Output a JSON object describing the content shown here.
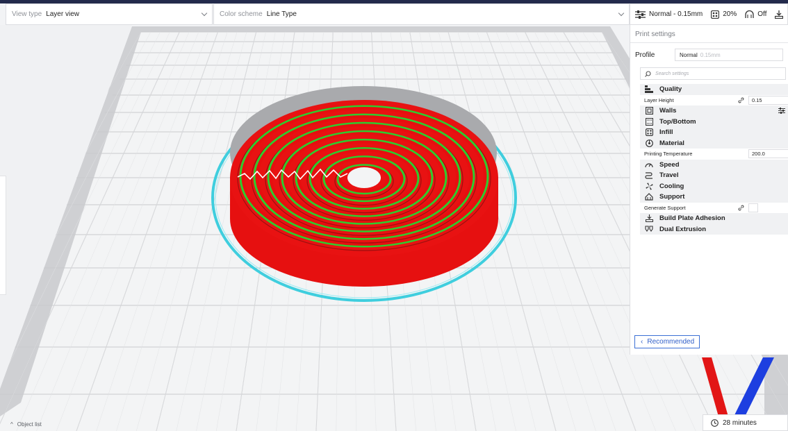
{
  "toolbar": {
    "view_type_label": "View type",
    "view_type_value": "Layer view",
    "color_scheme_label": "Color scheme",
    "color_scheme_value": "Line Type"
  },
  "print_bar": {
    "profile": "Normal - 0.15mm",
    "infill": "20%",
    "support": "Off"
  },
  "panel": {
    "title": "Print settings",
    "profile_label": "Profile",
    "profile_value": "Normal",
    "profile_sub": "0.15mm",
    "search_placeholder": "Search settings",
    "categories": [
      {
        "label": "Quality",
        "icon": "quality-icon"
      },
      {
        "label": "Walls",
        "icon": "walls-icon"
      },
      {
        "label": "Top/Bottom",
        "icon": "top-bottom-icon"
      },
      {
        "label": "Infill",
        "icon": "infill-icon"
      },
      {
        "label": "Material",
        "icon": "material-icon"
      },
      {
        "label": "Speed",
        "icon": "speed-icon"
      },
      {
        "label": "Travel",
        "icon": "travel-icon"
      },
      {
        "label": "Cooling",
        "icon": "cooling-icon"
      },
      {
        "label": "Support",
        "icon": "support-icon"
      },
      {
        "label": "Build Plate Adhesion",
        "icon": "adhesion-icon"
      },
      {
        "label": "Dual Extrusion",
        "icon": "dual-extrusion-icon"
      }
    ],
    "settings": {
      "layer_height_label": "Layer Height",
      "layer_height_value": "0.15",
      "printing_temp_label": "Printing Temperature",
      "printing_temp_value": "200.0",
      "generate_support_label": "Generate Support"
    },
    "recommended_button": "Recommended"
  },
  "object_list_label": "Object list",
  "print_time": "28 minutes",
  "colors": {
    "wall": "#e60f0f",
    "inner_wall": "#2ecc2e",
    "skirt": "#2ec8d8",
    "accent": "#2f5ec8"
  }
}
